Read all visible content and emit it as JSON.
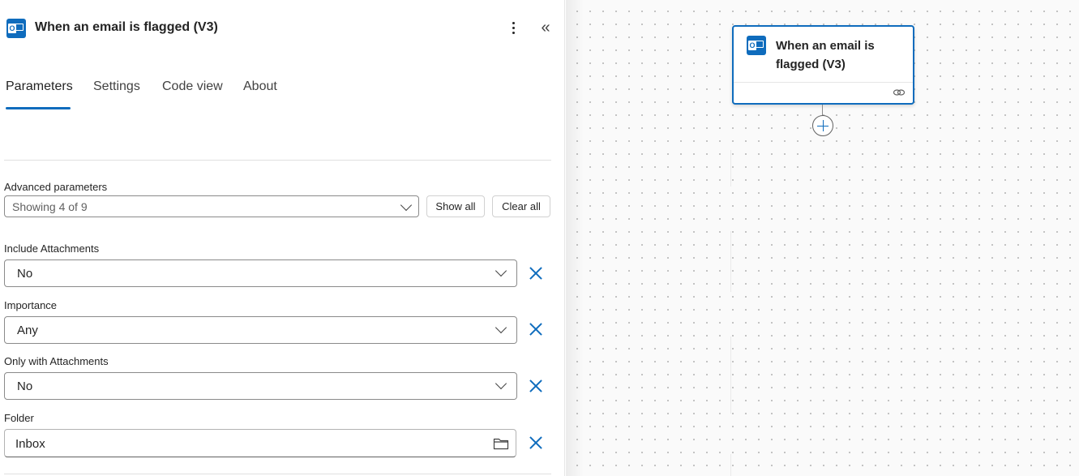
{
  "panel": {
    "title": "When an email is flagged (V3)",
    "tabs": [
      {
        "label": "Parameters",
        "active": true
      },
      {
        "label": "Settings",
        "active": false
      },
      {
        "label": "Code view",
        "active": false
      },
      {
        "label": "About",
        "active": false
      }
    ],
    "advanced": {
      "label": "Advanced parameters",
      "value": "Showing 4 of 9",
      "show_all": "Show all",
      "clear_all": "Clear all"
    },
    "fields": [
      {
        "label": "Include Attachments",
        "value": "No"
      },
      {
        "label": "Importance",
        "value": "Any"
      },
      {
        "label": "Only with Attachments",
        "value": "No"
      },
      {
        "label": "Folder",
        "value": "Inbox"
      }
    ]
  },
  "canvas": {
    "node": {
      "title": "When an email is flagged (V3)"
    }
  },
  "colors": {
    "accent": "#0f6cbd"
  }
}
